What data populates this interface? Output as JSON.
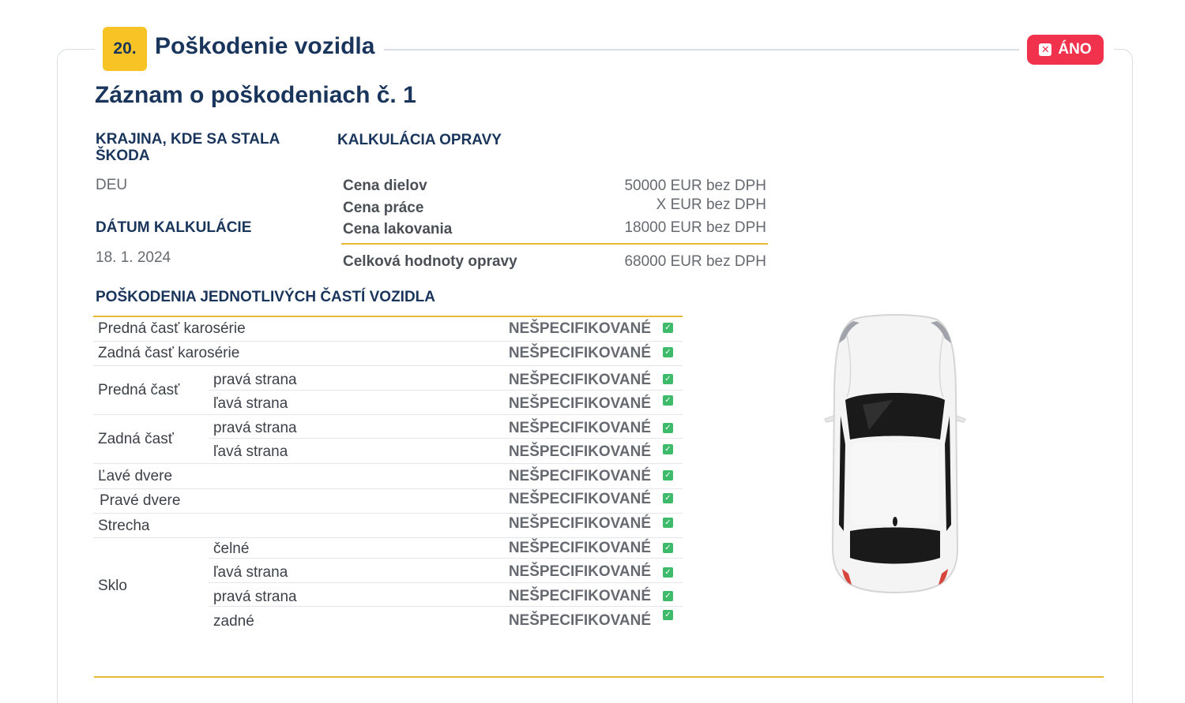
{
  "section": {
    "number": "20.",
    "title": "Poškodenie vozidla",
    "toggle_label": "ÁNO",
    "toggle_color": "#f0324d",
    "accent_color": "#f7c325"
  },
  "record": {
    "title": "Záznam o poškodeniach č. 1",
    "country_label": "KRAJINA, KDE SA STALA ŠKODA",
    "country_value": "DEU",
    "date_label": "DÁTUM KALKULÁCIE",
    "date_value": "18. 1. 2024",
    "calc_label": "KALKULÁCIA OPRAVY",
    "costs": [
      {
        "label": "Cena dielov",
        "value": "50000 EUR bez DPH"
      },
      {
        "label": "Cena práce",
        "value": "X EUR bez DPH"
      },
      {
        "label": "Cena lakovania",
        "value": "18000 EUR bez DPH"
      }
    ],
    "total": {
      "label": "Celková hodnoty opravy",
      "value": "68000 EUR bez DPH"
    }
  },
  "damages": {
    "title": "POŠKODENIA JEDNOTLIVÝCH ČASTÍ VOZIDLA",
    "status_text": "NEŠPECIFIKOVANÉ",
    "check_icon": "check-icon",
    "groups": [
      {
        "part": "Predná časť karosérie",
        "sides": [
          ""
        ]
      },
      {
        "part": "Zadná časť karosérie",
        "sides": [
          ""
        ]
      },
      {
        "part": "Predná časť",
        "sides": [
          "pravá strana",
          "ľavá strana"
        ]
      },
      {
        "part": "Zadná časť",
        "sides": [
          "pravá strana",
          "ľavá strana"
        ]
      },
      {
        "part": "Ľavé dvere",
        "sides": [
          ""
        ]
      },
      {
        "part": "Pravé dvere",
        "sides": [
          ""
        ]
      },
      {
        "part": "Strecha",
        "sides": [
          ""
        ]
      },
      {
        "part": "Sklo",
        "sides": [
          "čelné",
          "ľavá strana",
          "pravá strana",
          "zadné"
        ]
      }
    ]
  },
  "car_image": "car-top-view-icon"
}
